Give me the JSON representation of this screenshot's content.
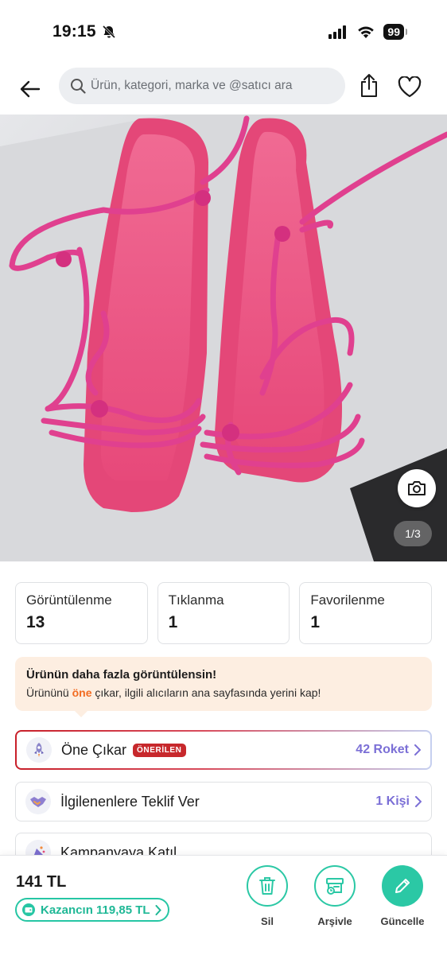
{
  "status_bar": {
    "time": "19:15",
    "battery": "99"
  },
  "header": {
    "search_placeholder": "Ürün, kategori, marka ve @satıcı ara"
  },
  "photo": {
    "counter": "1/3"
  },
  "stats": [
    {
      "label": "Görüntülenme",
      "value": "13"
    },
    {
      "label": "Tıklanma",
      "value": "1"
    },
    {
      "label": "Favorilenme",
      "value": "1"
    }
  ],
  "tip": {
    "title": "Ürünün daha fazla görüntülensin!",
    "body_prefix": "Ürününü ",
    "body_highlight": "öne",
    "body_suffix": " çıkar, ilgili alıcıların ana sayfasında yerini kap!"
  },
  "actions": [
    {
      "label": "Öne Çıkar",
      "badge": "ÖNERİLEN",
      "right": "42 Roket",
      "icon": "rocket-icon"
    },
    {
      "label": "İlgilenenlere Teklif Ver",
      "right": "1 Kişi",
      "icon": "handshake-icon"
    },
    {
      "label": "Kampanyaya Katıl",
      "icon": "party-icon"
    }
  ],
  "bottom": {
    "price": "141 TL",
    "earnings": "Kazancın 119,85 TL",
    "buttons": [
      {
        "label": "Sil",
        "icon": "trash-icon"
      },
      {
        "label": "Arşivle",
        "icon": "archive-icon"
      },
      {
        "label": "Güncelle",
        "icon": "pencil-icon"
      }
    ]
  },
  "colors": {
    "accent": "#2bc8a5",
    "promo": "#c7282c",
    "roket": "#7b6fd6",
    "highlight": "#f26b21"
  }
}
